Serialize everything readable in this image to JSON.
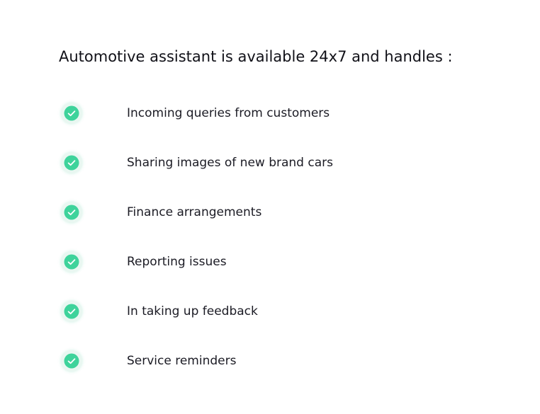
{
  "heading": "Automotive assistant is available 24x7 and handles :",
  "colors": {
    "check_fill": "#3ed39b",
    "check_halo": "#e9f7f1",
    "text": "#1b1b24"
  },
  "features": [
    {
      "icon": "check-circle-icon",
      "label": "Incoming queries from customers"
    },
    {
      "icon": "check-circle-icon",
      "label": "Sharing images of new brand cars"
    },
    {
      "icon": "check-circle-icon",
      "label": "Finance arrangements"
    },
    {
      "icon": "check-circle-icon",
      "label": "Reporting issues"
    },
    {
      "icon": "check-circle-icon",
      "label": "In taking up feedback"
    },
    {
      "icon": "check-circle-icon",
      "label": "Service reminders"
    }
  ]
}
